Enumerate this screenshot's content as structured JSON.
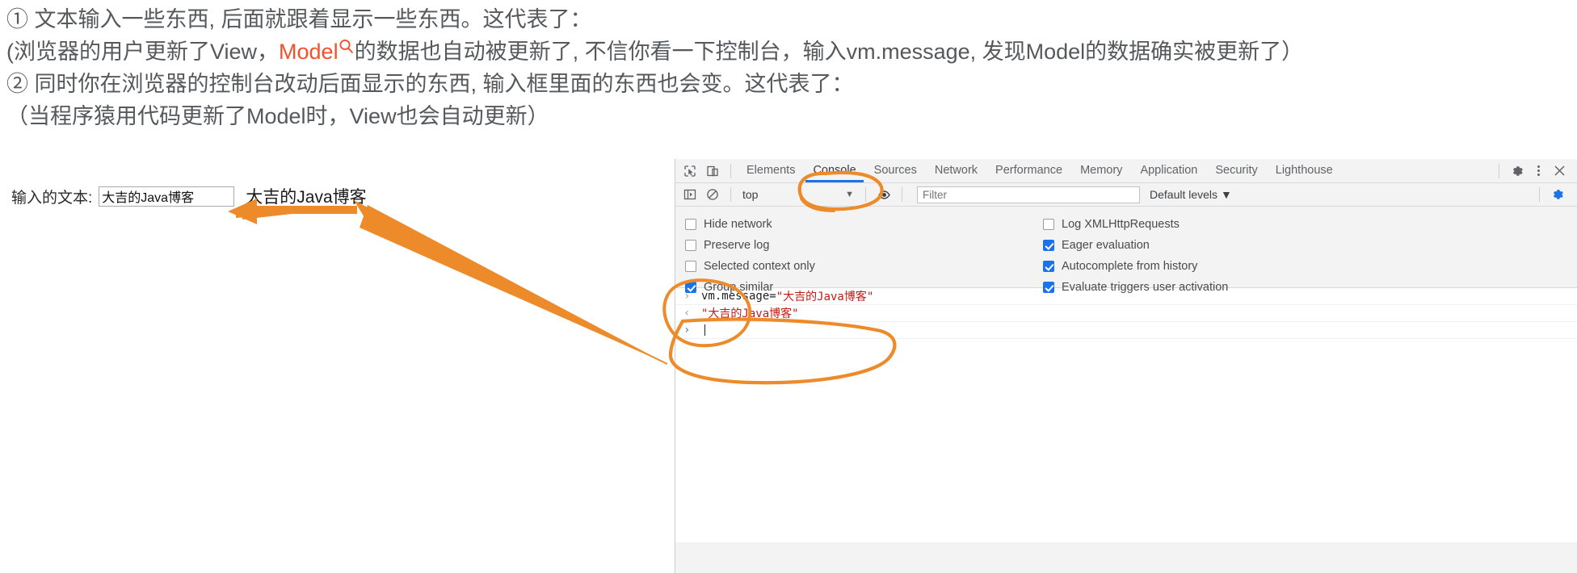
{
  "article": {
    "lines": [
      {
        "id": "line1",
        "parts": [
          {
            "t": "① 文本输入一些东西, 后面就跟着显示一些东西。这代表了："
          }
        ]
      },
      {
        "id": "line2_before",
        "text": "(浏览器的用户更新了View，"
      },
      {
        "id": "line2_model",
        "text": "Model"
      },
      {
        "id": "line2_after",
        "text": "的数据也自动被更新了, 不信你看一下控制台，输入vm.message, 发现Model的数据确实被更新了）"
      },
      {
        "id": "line3",
        "text": "② 同时你在浏览器的控制台改动后面显示的东西, 输入框里面的东西也会变。这代表了："
      },
      {
        "id": "line4",
        "text": "（当程序猿用代码更新了Model时，View也会自动更新）"
      }
    ],
    "model_icon_name": "search-icon",
    "highlight_color": "#f4502a"
  },
  "demo": {
    "input_label": "输入的文本:",
    "input_value": "大吉的Java博客",
    "input_placeholder": "",
    "mirror_text": "大吉的Java博客"
  },
  "devtools": {
    "left_icons": [
      {
        "name": "inspect-element-icon",
        "title": "Inspect"
      },
      {
        "name": "device-toolbar-icon",
        "title": "Toggle device toolbar"
      }
    ],
    "tabs": [
      {
        "label": "Elements",
        "active": false
      },
      {
        "label": "Console",
        "active": true
      },
      {
        "label": "Sources",
        "active": false
      },
      {
        "label": "Network",
        "active": false
      },
      {
        "label": "Performance",
        "active": false
      },
      {
        "label": "Memory",
        "active": false
      },
      {
        "label": "Application",
        "active": false
      },
      {
        "label": "Security",
        "active": false
      },
      {
        "label": "Lighthouse",
        "active": false
      }
    ],
    "tabbar_right": [
      {
        "name": "settings-gear-icon"
      },
      {
        "name": "more-options-icon"
      },
      {
        "name": "close-icon"
      }
    ],
    "active_tab_underline_color": "#1a73e8",
    "filterbar": {
      "sidebar_toggle_name": "console-sidebar-icon",
      "clear_console_name": "clear-console-icon",
      "context_value": "top",
      "context_caret": "▼",
      "eye_icon_name": "live-expression-icon",
      "filter_placeholder": "Filter",
      "filter_value": "",
      "levels_label": "Default levels",
      "levels_caret": "▼",
      "settings_gear_name": "console-settings-gear-icon"
    },
    "settings": {
      "left": [
        {
          "label": "Hide network",
          "checked": false
        },
        {
          "label": "Preserve log",
          "checked": false
        },
        {
          "label": "Selected context only",
          "checked": false
        },
        {
          "label": "Group similar",
          "checked": true
        }
      ],
      "right": [
        {
          "label": "Log XMLHttpRequests",
          "checked": false
        },
        {
          "label": "Eager evaluation",
          "checked": true
        },
        {
          "label": "Autocomplete from history",
          "checked": true
        },
        {
          "label": "Evaluate triggers user activation",
          "checked": true
        }
      ]
    },
    "console_log": [
      {
        "glyph": "›",
        "kind": "input",
        "plain": "vm.message=",
        "string": "\"大吉的Java博客\""
      },
      {
        "glyph": "‹",
        "kind": "output",
        "plain": "",
        "string": "\"大吉的Java博客\""
      },
      {
        "glyph": "›",
        "kind": "prompt",
        "plain": "",
        "string": ""
      }
    ]
  },
  "annotations": {
    "color": "#ED8B2B",
    "items": [
      {
        "name": "annotation-circle-console-tab",
        "shape": "ellipse"
      },
      {
        "name": "annotation-circle-console-output",
        "shape": "ellipse"
      },
      {
        "name": "annotation-arrow-to-input",
        "shape": "arrow"
      },
      {
        "name": "annotation-arrow-to-mirror",
        "shape": "arrow"
      }
    ]
  }
}
